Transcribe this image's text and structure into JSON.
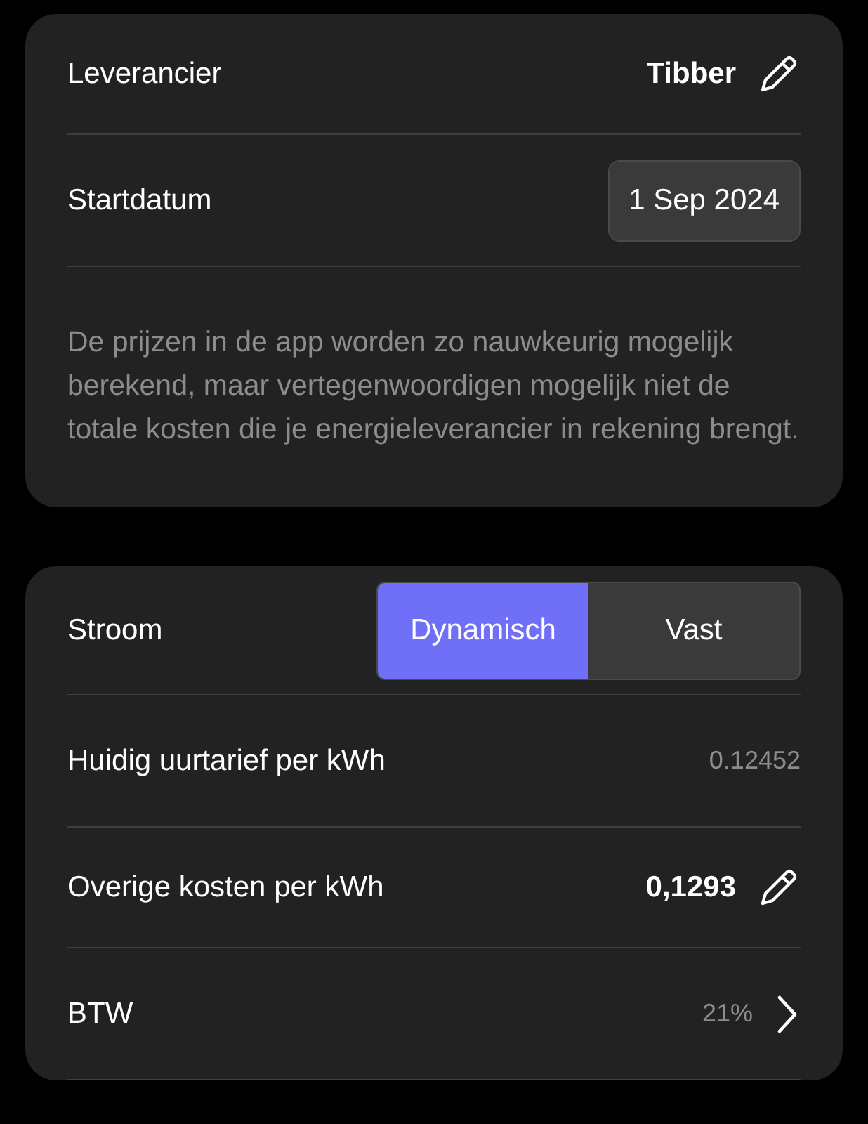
{
  "contract": {
    "supplier": {
      "label": "Leverancier",
      "value": "Tibber"
    },
    "start_date": {
      "label": "Startdatum",
      "value": "1 Sep 2024"
    },
    "note": "De prijzen in de app worden zo nauwkeurig mogelijk berekend, maar vertegenwoordigen mogelijk niet de totale kosten die je energieleverancier in rekening brengt."
  },
  "electricity": {
    "label": "Stroom",
    "segments": [
      {
        "label": "Dynamisch",
        "selected": true
      },
      {
        "label": "Vast",
        "selected": false
      }
    ],
    "rows": [
      {
        "kind": "reading",
        "label": "Huidig uurtarief per kWh",
        "value": "0.12452"
      },
      {
        "kind": "editable",
        "label": "Overige kosten per kWh",
        "value": "0,1293"
      },
      {
        "kind": "link",
        "label": "BTW",
        "value": "21%"
      }
    ]
  }
}
